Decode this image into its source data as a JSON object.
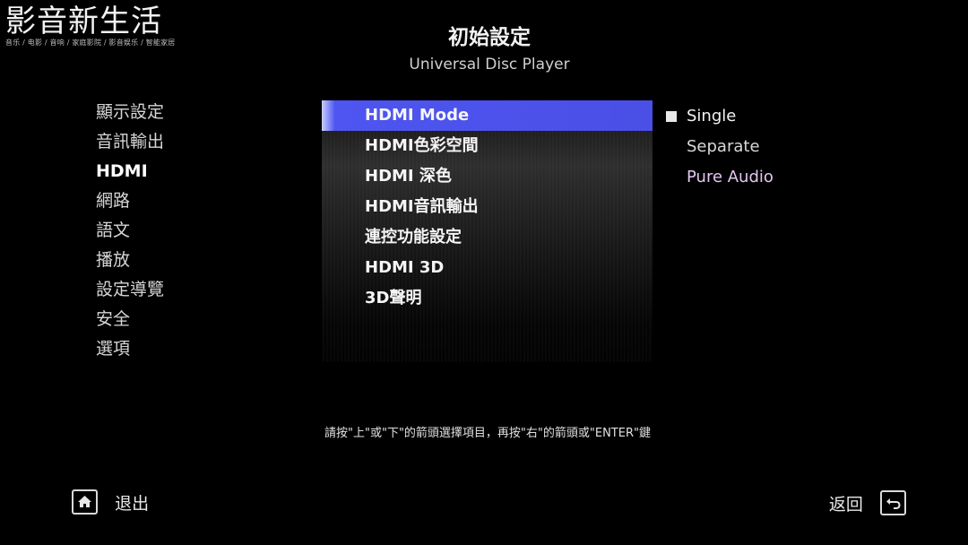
{
  "watermark": {
    "title": "影音新生活",
    "subtitle": "音乐 / 电影 / 音响 / 家庭影院 / 影音娱乐 / 智能家居"
  },
  "header": {
    "title": "初始設定",
    "subtitle": "Universal Disc Player"
  },
  "left_nav": {
    "active_index": 2,
    "items": [
      {
        "label": "顯示設定"
      },
      {
        "label": "音訊輸出"
      },
      {
        "label": "HDMI"
      },
      {
        "label": "網路"
      },
      {
        "label": "語文"
      },
      {
        "label": "播放"
      },
      {
        "label": "設定導覽"
      },
      {
        "label": "安全"
      },
      {
        "label": "選項"
      }
    ]
  },
  "menu": {
    "selected_index": 0,
    "items": [
      {
        "label": "HDMI Mode"
      },
      {
        "label": "HDMI色彩空間"
      },
      {
        "label": "HDMI 深色"
      },
      {
        "label": "HDMI音訊輸出"
      },
      {
        "label": "連控功能設定"
      },
      {
        "label": "HDMI 3D"
      },
      {
        "label": "3D聲明"
      }
    ],
    "highlight_color": "#4a4fe6"
  },
  "options": {
    "selected_index": 0,
    "items": [
      {
        "label": "Single"
      },
      {
        "label": "Separate"
      },
      {
        "label": "Pure Audio"
      }
    ]
  },
  "instruction": "請按\"上\"或\"下\"的箭頭選擇項目，再按\"右\"的箭頭或\"ENTER\"鍵",
  "footer": {
    "exit_label": "退出",
    "exit_icon": "home-icon",
    "back_label": "返回",
    "back_icon": "return-arrow-icon"
  }
}
